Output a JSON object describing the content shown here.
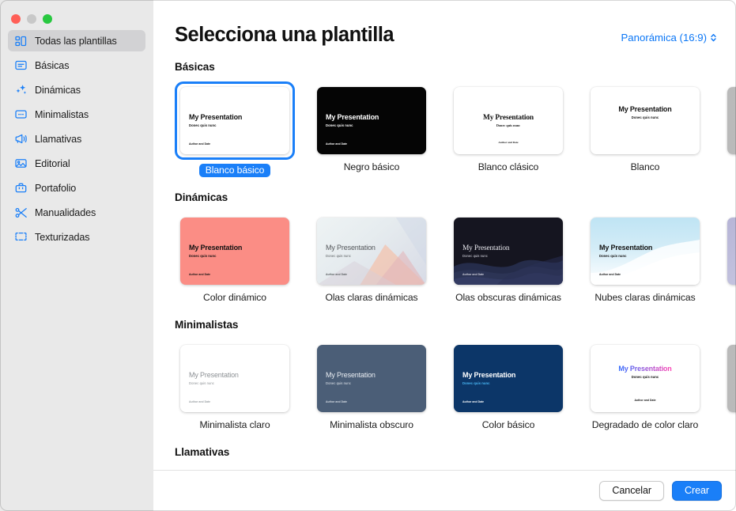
{
  "window": {
    "traffic_lights": [
      {
        "name": "close",
        "color": "#ff5f57"
      },
      {
        "name": "minimize",
        "color": "#c8c8c8"
      },
      {
        "name": "maximize",
        "color": "#28c840"
      }
    ]
  },
  "sidebar": {
    "items": [
      {
        "label": "Todas las plantillas",
        "icon": "grid-blocks-icon",
        "active": true
      },
      {
        "label": "Básicas",
        "icon": "rectangle-lines-icon",
        "active": false
      },
      {
        "label": "Dinámicas",
        "icon": "sparkles-icon",
        "active": false
      },
      {
        "label": "Minimalistas",
        "icon": "dotted-rectangle-icon",
        "active": false
      },
      {
        "label": "Llamativas",
        "icon": "megaphone-icon",
        "active": false
      },
      {
        "label": "Editorial",
        "icon": "photo-icon",
        "active": false
      },
      {
        "label": "Portafolio",
        "icon": "briefcase-icon",
        "active": false
      },
      {
        "label": "Manualidades",
        "icon": "scissors-icon",
        "active": false
      },
      {
        "label": "Texturizadas",
        "icon": "dashed-frame-icon",
        "active": false
      }
    ]
  },
  "header": {
    "title": "Selecciona una plantilla",
    "aspect_label": "Panorámica (16:9)",
    "aspect_icon": "chevron-up-down-icon",
    "accent_color": "#0a76f6"
  },
  "slide_text": {
    "title": "My Presentation",
    "subtitle": "Donec quis nunc",
    "footer": "Author and Date"
  },
  "sections": [
    {
      "title": "Básicas",
      "templates": [
        {
          "label": "Blanco básico",
          "selected": true,
          "style": "white-left"
        },
        {
          "label": "Negro básico",
          "selected": false,
          "style": "black-left"
        },
        {
          "label": "Blanco clásico",
          "selected": false,
          "style": "white-serif-center"
        },
        {
          "label": "Blanco",
          "selected": false,
          "style": "white-sans-center"
        },
        {
          "label": "",
          "selected": false,
          "style": "partial-gray"
        }
      ]
    },
    {
      "title": "Dinámicas",
      "templates": [
        {
          "label": "Color dinámico",
          "selected": false,
          "style": "coral"
        },
        {
          "label": "Olas claras dinámicas",
          "selected": false,
          "style": "light-waves"
        },
        {
          "label": "Olas obscuras dinámicas",
          "selected": false,
          "style": "dark-waves"
        },
        {
          "label": "Nubes claras dinámicas",
          "selected": false,
          "style": "light-clouds"
        },
        {
          "label": "",
          "selected": false,
          "style": "partial-gradient"
        }
      ]
    },
    {
      "title": "Minimalistas",
      "templates": [
        {
          "label": "Minimalista claro",
          "selected": false,
          "style": "minimal-light"
        },
        {
          "label": "Minimalista obscuro",
          "selected": false,
          "style": "minimal-dark"
        },
        {
          "label": "Color básico",
          "selected": false,
          "style": "navy"
        },
        {
          "label": "Degradado de color claro",
          "selected": false,
          "style": "gradient-text"
        },
        {
          "label": "",
          "selected": false,
          "style": "partial-gray"
        }
      ]
    },
    {
      "title": "Llamativas",
      "templates": []
    }
  ],
  "footer": {
    "cancel_label": "Cancelar",
    "create_label": "Crear",
    "create_color": "#1a7ff8"
  }
}
